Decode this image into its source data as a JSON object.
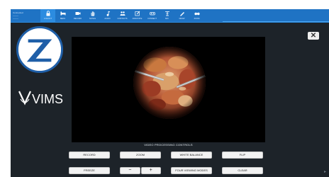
{
  "status": {
    "lines": [
      "Connected",
      "--------",
      "--------"
    ]
  },
  "toolbar": {
    "tools": [
      {
        "label": "LOGOUT",
        "icon": "lock-icon",
        "active": true
      },
      {
        "label": "BEDS",
        "icon": "bed-icon"
      },
      {
        "label": "RECORD",
        "icon": "video-camera-icon"
      },
      {
        "label": "NOTES",
        "icon": "hand-icon"
      },
      {
        "label": "AUDIO",
        "icon": "music-note-icon"
      },
      {
        "label": "CONTACTS",
        "icon": "people-icon"
      },
      {
        "label": "ANNOTATE",
        "icon": "pen-box-icon"
      },
      {
        "label": "CONNECT",
        "icon": "vr-goggles-icon"
      },
      {
        "label": "MIC",
        "icon": "microphone-stand-icon"
      },
      {
        "label": "DRAW",
        "icon": "pencil-icon"
      },
      {
        "label": "ZOOM",
        "icon": "binoculars-icon"
      }
    ]
  },
  "branding": {
    "vims": "VIMS"
  },
  "close": {
    "label": "✕"
  },
  "controls": {
    "title": "VIDEO PROCESSING CONTROLS",
    "row1": [
      "RECORD",
      "ZOOM",
      "WHITE BALANCE",
      "FLIP"
    ],
    "row2": [
      "FREEZE",
      "FOUR VIEWING MODES",
      "CLEAR"
    ],
    "zoom_minus": "−",
    "zoom_plus": "+"
  },
  "colors": {
    "toolbar": "#1f73c4",
    "background": "#1d2329",
    "logo_blue": "#1f5fa8"
  }
}
